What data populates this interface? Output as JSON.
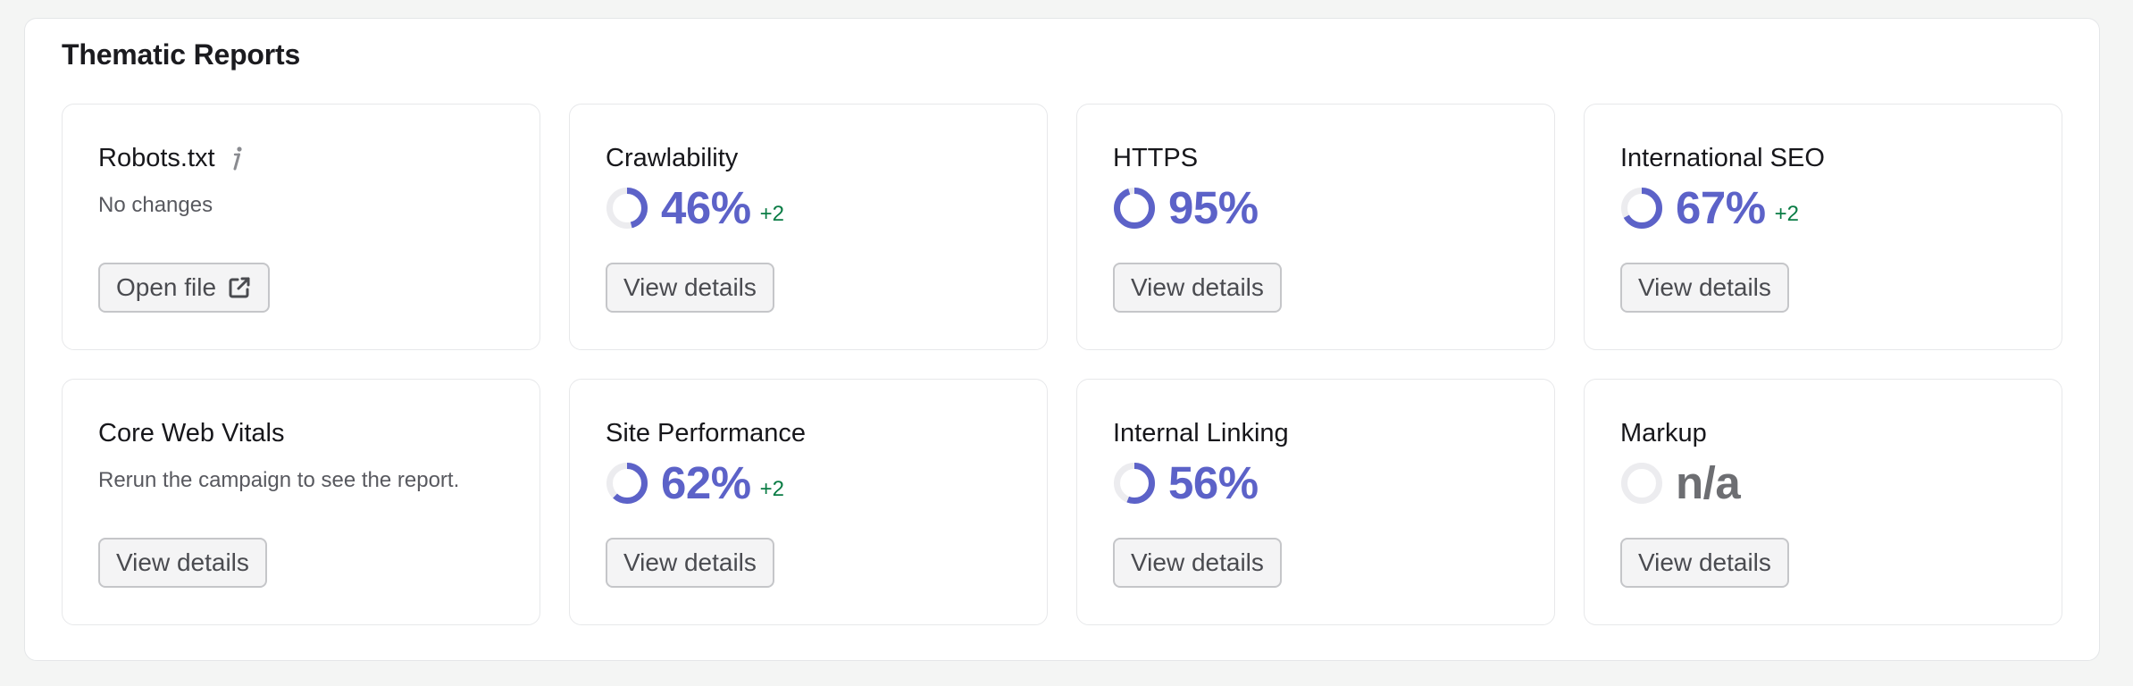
{
  "title": "Thematic Reports",
  "colors": {
    "accent": "#5c62c8",
    "track": "#ececef",
    "positive": "#0a7c45",
    "muted_value": "#6d6e72"
  },
  "cards": [
    {
      "title": "Robots.txt",
      "has_info_icon": true,
      "description": "No changes",
      "button_label": "Open file",
      "button_icon": "external-link-icon"
    },
    {
      "title": "Crawlability",
      "value_label": "46%",
      "percent": 46,
      "delta": "+2",
      "button_label": "View details"
    },
    {
      "title": "HTTPS",
      "value_label": "95%",
      "percent": 95,
      "button_label": "View details"
    },
    {
      "title": "International SEO",
      "value_label": "67%",
      "percent": 67,
      "delta": "+2",
      "button_label": "View details"
    },
    {
      "title": "Core Web Vitals",
      "description": "Rerun the campaign to see the report.",
      "button_label": "View details"
    },
    {
      "title": "Site Performance",
      "value_label": "62%",
      "percent": 62,
      "delta": "+2",
      "button_label": "View details"
    },
    {
      "title": "Internal Linking",
      "value_label": "56%",
      "percent": 56,
      "button_label": "View details"
    },
    {
      "title": "Markup",
      "value_label": "n/a",
      "percent": null,
      "button_label": "View details"
    }
  ]
}
